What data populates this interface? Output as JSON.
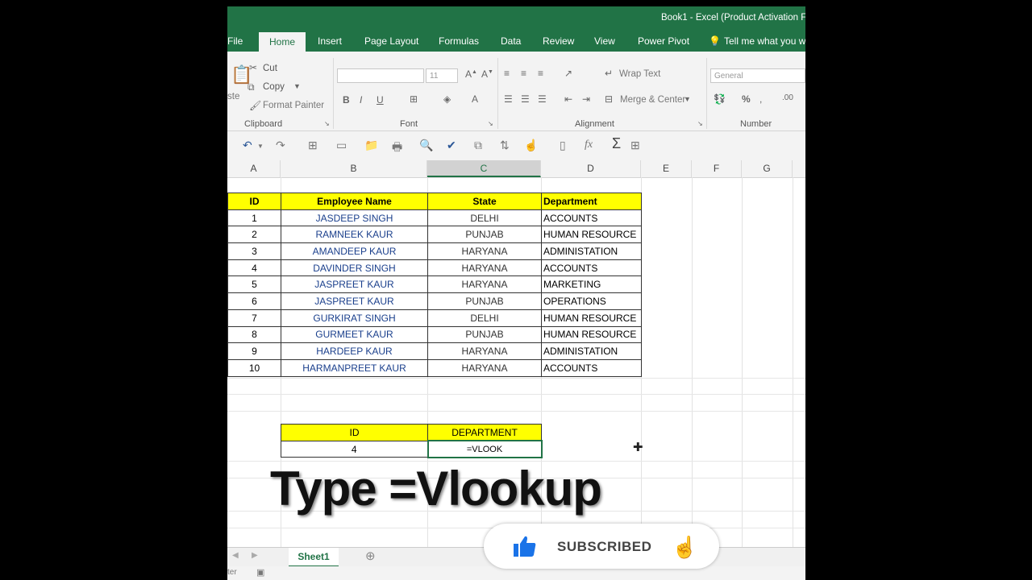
{
  "window": {
    "title": "Book1 - Excel (Product Activation F"
  },
  "tabs": [
    "File",
    "Home",
    "Insert",
    "Page Layout",
    "Formulas",
    "Data",
    "Review",
    "View",
    "Power Pivot"
  ],
  "active_tab": "Home",
  "tell_me": "Tell me what you w",
  "clipboard": {
    "paste": "ste",
    "cut": "Cut",
    "copy": "Copy",
    "format_painter": "Format Painter",
    "group": "Clipboard"
  },
  "font": {
    "size": "11",
    "group": "Font",
    "bold": "B",
    "italic": "I",
    "underline": "U"
  },
  "alignment": {
    "wrap_text": "Wrap Text",
    "merge_center": "Merge & Center",
    "group": "Alignment"
  },
  "number": {
    "format": "General",
    "group": "Number",
    "percent": "%"
  },
  "columns": [
    "A",
    "B",
    "C",
    "D",
    "E",
    "F",
    "G"
  ],
  "selected_column": "C",
  "table": {
    "headers": [
      "ID",
      "Employee Name",
      "State",
      "Department"
    ],
    "rows": [
      [
        "1",
        "JASDEEP SINGH",
        "DELHI",
        "ACCOUNTS"
      ],
      [
        "2",
        "RAMNEEK KAUR",
        "PUNJAB",
        "HUMAN RESOURCE"
      ],
      [
        "3",
        "AMANDEEP KAUR",
        "HARYANA",
        "ADMINISTATION"
      ],
      [
        "4",
        "DAVINDER SINGH",
        "HARYANA",
        "ACCOUNTS"
      ],
      [
        "5",
        "JASPREET KAUR",
        "HARYANA",
        "MARKETING"
      ],
      [
        "6",
        "JASPREET KAUR",
        "PUNJAB",
        "OPERATIONS"
      ],
      [
        "7",
        "GURKIRAT SINGH",
        "DELHI",
        "HUMAN RESOURCE"
      ],
      [
        "8",
        "GURMEET KAUR",
        "PUNJAB",
        "HUMAN RESOURCE"
      ],
      [
        "9",
        "HARDEEP KAUR",
        "HARYANA",
        "ADMINISTATION"
      ],
      [
        "10",
        "HARMANPREET KAUR",
        "HARYANA",
        "ACCOUNTS"
      ]
    ]
  },
  "lookup": {
    "headers": [
      "ID",
      "DEPARTMENT"
    ],
    "id_value": "4",
    "formula": "=VLOOK"
  },
  "overlay_text": "Type =Vlookup",
  "sheet_tab": "Sheet1",
  "status_text": "ter",
  "subscribe": {
    "label": "SUBSCRIBED"
  },
  "colors": {
    "excel_green": "#217346",
    "header_yellow": "#ffff00",
    "like_blue": "#1a73e8"
  }
}
